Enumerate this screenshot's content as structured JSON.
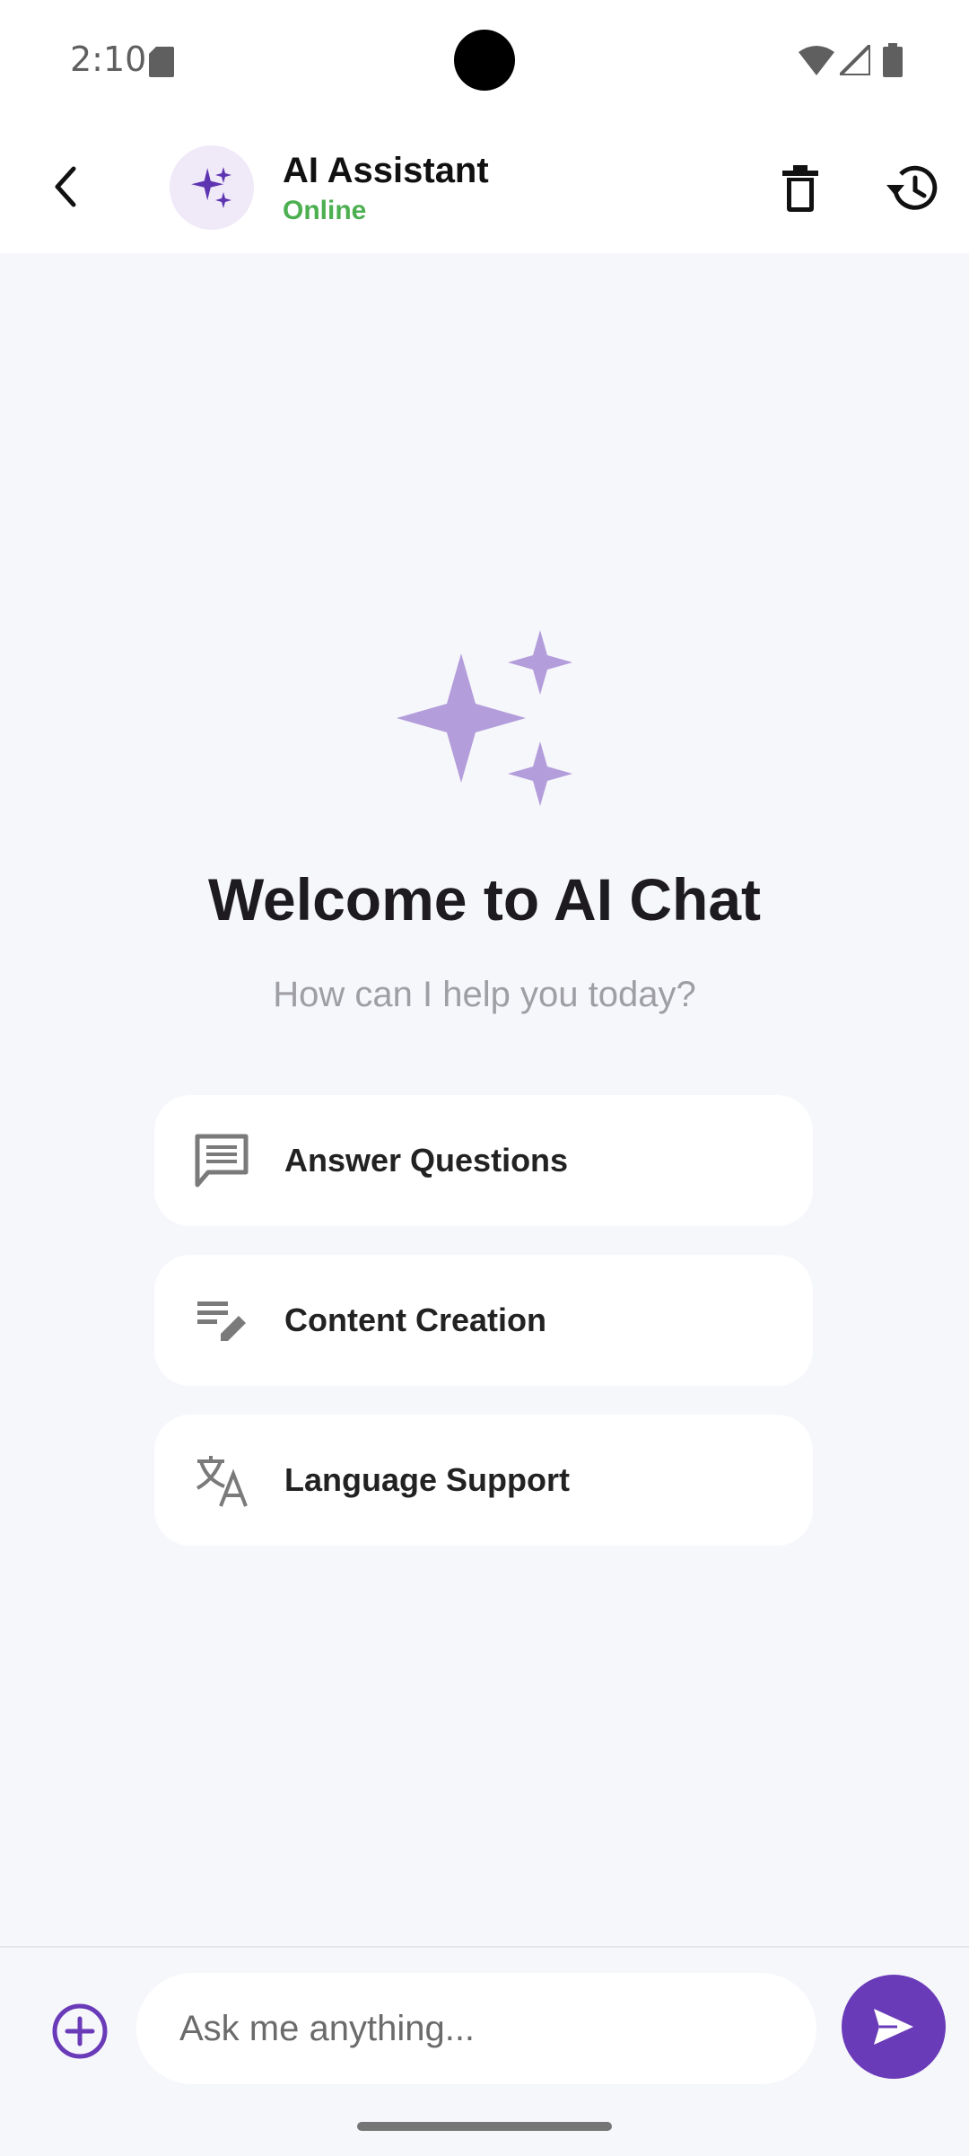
{
  "status_bar": {
    "time": "2:10"
  },
  "header": {
    "title": "AI Assistant",
    "status": "Online",
    "status_color": "#4caf50"
  },
  "welcome": {
    "title": "Welcome to AI Chat",
    "subtitle": "How can I help you today?"
  },
  "suggestions": [
    {
      "label": "Answer Questions",
      "icon": "chat-icon"
    },
    {
      "label": "Content Creation",
      "icon": "edit-note-icon"
    },
    {
      "label": "Language Support",
      "icon": "translate-icon"
    }
  ],
  "input": {
    "placeholder": "Ask me anything..."
  },
  "colors": {
    "accent": "#6a3bb8",
    "accent_light": "#b39ddb",
    "avatar_bg": "#efe9f8",
    "background": "#f6f7fb"
  }
}
